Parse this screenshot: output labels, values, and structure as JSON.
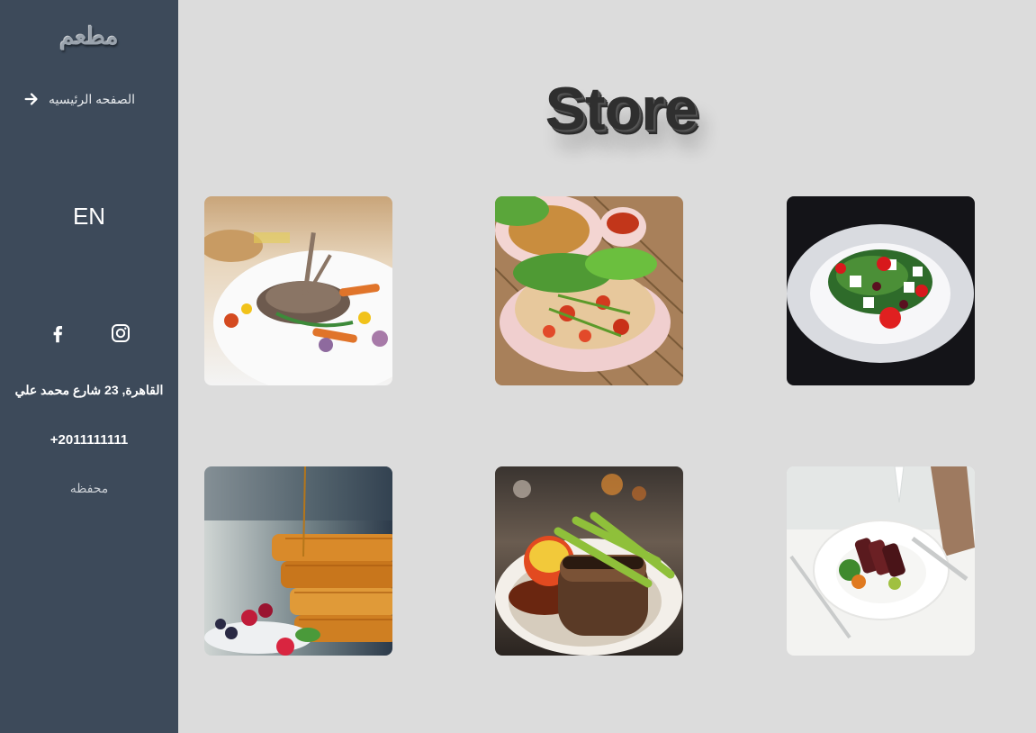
{
  "sidebar": {
    "logo": "مطعم",
    "home_link": "الصفحه الرئيسيه",
    "language": "EN",
    "socials": [
      {
        "icon": "facebook-icon"
      },
      {
        "icon": "instagram-icon"
      }
    ],
    "address": "القاهرة, 23 شارع محمد علي",
    "phone": "+2011111111",
    "footer": "محفظه"
  },
  "main": {
    "title": "Store",
    "products": [
      {
        "image": "lamb-chops-plate"
      },
      {
        "image": "papaya-salad-plate"
      },
      {
        "image": "greek-salad-plate"
      },
      {
        "image": "waffles-with-berries"
      },
      {
        "image": "glazed-steak-plate"
      },
      {
        "image": "sliced-beef-plate"
      }
    ]
  },
  "colors": {
    "sidebar_bg": "#3d4a5a",
    "page_bg": "#dcdcdc",
    "title_color": "#2f2f2f"
  }
}
